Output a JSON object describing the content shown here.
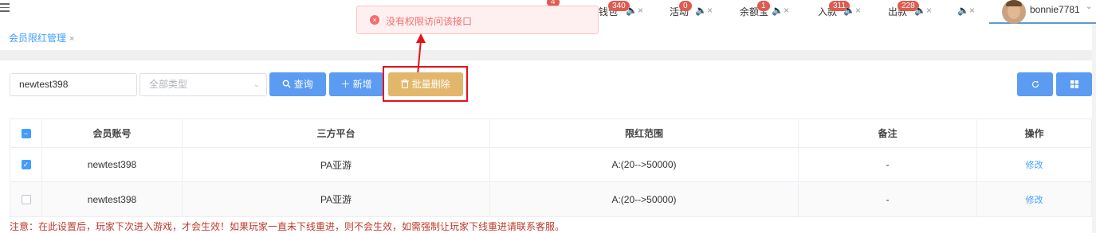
{
  "topbar": {
    "items": [
      {
        "label": "钱包",
        "badge": "340"
      },
      {
        "label": "活动",
        "badge": "0"
      },
      {
        "label": "余额宝",
        "badge": "1"
      },
      {
        "label": "入款",
        "badge": "311"
      },
      {
        "label": "出款",
        "badge": "228"
      }
    ],
    "first_badge": "4",
    "mute_glyph": "🔈×",
    "username": "bonnie7781"
  },
  "tabs": [
    {
      "label": "会员限红管理",
      "close": "×"
    }
  ],
  "toast": {
    "message": "没有权限访问该接口",
    "icon": "×"
  },
  "filters": {
    "account_value": "newtest398",
    "type_placeholder": "全部类型",
    "search_label": "查询",
    "add_label": "新增",
    "batch_delete_label": "批量删除"
  },
  "table": {
    "columns": [
      "会员账号",
      "三方平台",
      "限红范围",
      "备注",
      "操作"
    ],
    "rows": [
      {
        "checked": true,
        "account": "newtest398",
        "platform": "PA亚游",
        "range": "A:(20-->50000)",
        "remark": "-",
        "action": "修改"
      },
      {
        "checked": false,
        "account": "newtest398",
        "platform": "PA亚游",
        "range": "A:(20-->50000)",
        "remark": "-",
        "action": "修改"
      }
    ]
  },
  "note": "注意：在此设置后，玩家下次进入游戏，才会生效！如果玩家一直未下线重进，则不会生效，如需强制让玩家下线重进请联系客服。",
  "colors": {
    "accent": "#409eff",
    "danger": "#f56c6c",
    "gold": "#e3b76b",
    "highlight": "#e3121c"
  }
}
